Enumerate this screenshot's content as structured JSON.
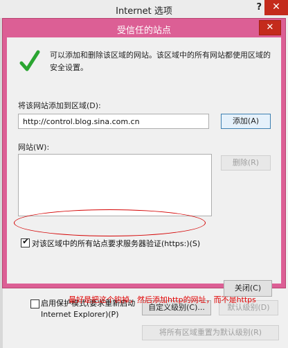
{
  "parent": {
    "title": "Internet 选项",
    "help": "?",
    "close": "✕",
    "protected_mode_line1": "启用保护模式(要求重新启动",
    "protected_mode_line2": "Internet Explorer)(P)",
    "custom_level_button": "自定义级别(C)...",
    "default_level_button": "默认级别(D)",
    "reset_all_button": "将所有区域重置为默认级别(R)"
  },
  "dialog": {
    "title": "受信任的站点",
    "close": "✕",
    "info": "可以添加和删除该区域的网站。该区域中的所有网站都使用区域的安全设置。",
    "add_label": "将该网站添加到区域(D):",
    "site_value": "http://control.blog.sina.com.cn",
    "add_button": "添加(A)",
    "websites_label": "网站(W):",
    "remove_button": "删除(R)",
    "https_label": "对该区域中的所有站点要求服务器验证(https:)(S)",
    "https_checked": true,
    "close_button": "关闭(C)"
  },
  "annotation": "最好是把这个钩掉，然后添加http的网址，而不是https",
  "colors": {
    "dialog_frame": "#dc5f95",
    "close_red": "#c42b1c",
    "annotation_red": "#e00000",
    "check_green": "#2aa531"
  }
}
